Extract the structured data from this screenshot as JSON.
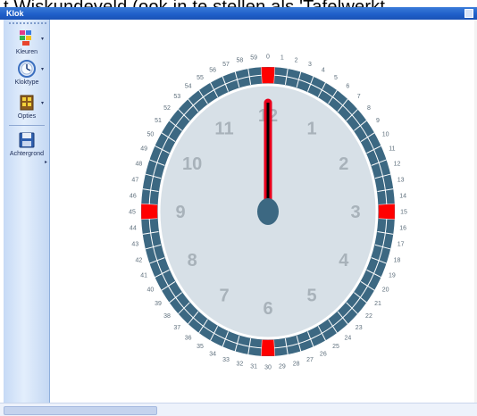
{
  "banner_text": "t Wiskundeveld (ook in te stellen als 'Tafelwerkt",
  "window": {
    "title": "Klok"
  },
  "toolbar": {
    "items": [
      {
        "label": "Kleuren",
        "icon": "palette-icon"
      },
      {
        "label": "Kloktype",
        "icon": "clock-type-icon"
      },
      {
        "label": "Opties",
        "icon": "options-icon"
      },
      {
        "label": "Achtergrond",
        "icon": "floppy-disk-icon"
      }
    ]
  },
  "clock": {
    "hour_numbers": [
      "1",
      "2",
      "3",
      "4",
      "5",
      "6",
      "7",
      "8",
      "9",
      "10",
      "11",
      "12"
    ],
    "minute_numbers": [
      "0",
      "1",
      "2",
      "3",
      "4",
      "5",
      "6",
      "7",
      "8",
      "9",
      "10",
      "11",
      "12",
      "13",
      "14",
      "15",
      "16",
      "17",
      "18",
      "19",
      "20",
      "21",
      "22",
      "23",
      "24",
      "25",
      "26",
      "27",
      "28",
      "29",
      "30",
      "31",
      "32",
      "33",
      "34",
      "35",
      "36",
      "37",
      "38",
      "39",
      "40",
      "41",
      "42",
      "43",
      "44",
      "45",
      "46",
      "47",
      "48",
      "49",
      "50",
      "51",
      "52",
      "53",
      "54",
      "55",
      "56",
      "57",
      "58",
      "59"
    ],
    "time": {
      "hour": 12,
      "minute": 0
    },
    "colors": {
      "ring": "#3c6882",
      "face": "#d7e0e7",
      "hour_number": "#a8b2ba",
      "minute_number": "#5e6f7c",
      "markers": "#ff0000",
      "hand": "#000000",
      "hand_glow": "#e8001c",
      "hub": "#3c6882"
    }
  }
}
